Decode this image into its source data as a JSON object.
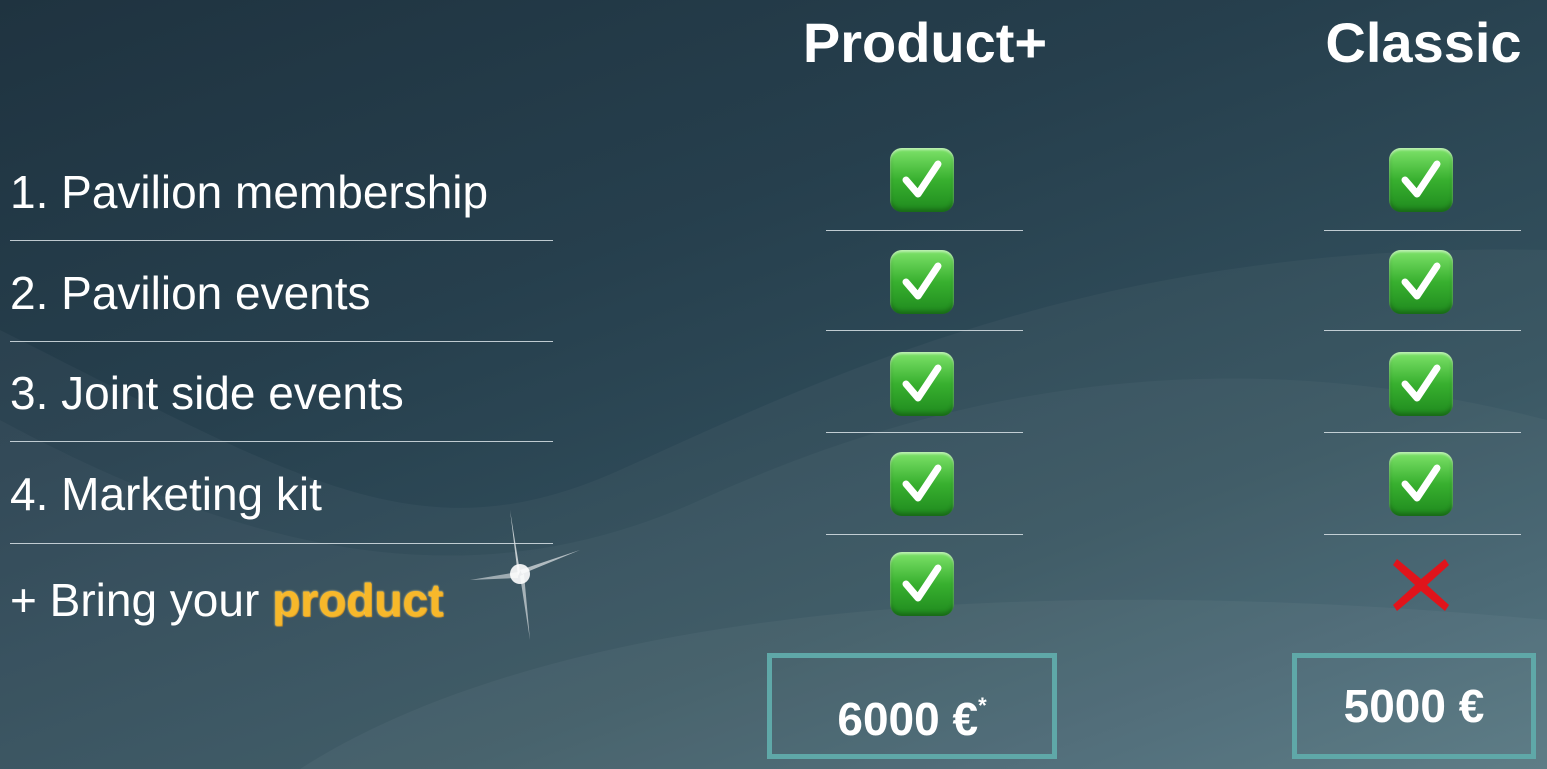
{
  "columns": {
    "product_plus": "Product+",
    "classic": "Classic"
  },
  "rows": [
    {
      "label": "1. Pavilion membership",
      "product_plus": true,
      "classic": true
    },
    {
      "label": "2. Pavilion events",
      "product_plus": true,
      "classic": true
    },
    {
      "label": "3. Joint side events",
      "product_plus": true,
      "classic": true
    },
    {
      "label": "4. Marketing kit",
      "product_plus": true,
      "classic": true
    },
    {
      "label_prefix": "+ Bring your ",
      "label_highlight": "product",
      "product_plus": true,
      "classic": false
    }
  ],
  "prices": {
    "product_plus": "6000 €",
    "product_plus_note": "*",
    "classic": "5000 €"
  },
  "icons": {
    "included": "check-mark-icon",
    "excluded": "cross-mark-icon",
    "decoration": "sparkle-icon"
  },
  "colors": {
    "included": "#38b02f",
    "excluded": "#e0141b",
    "highlight": "#f7b82a",
    "price_border": "#5fa8a8"
  }
}
